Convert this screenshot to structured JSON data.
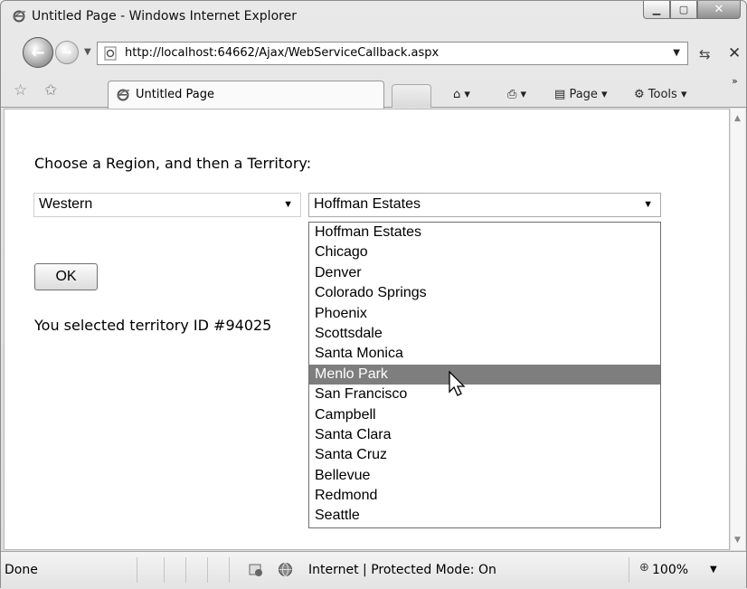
{
  "window": {
    "title": "Untitled Page - Windows Internet Explorer",
    "buttons": [
      "minimize",
      "maximize",
      "close"
    ]
  },
  "navigation": {
    "back_icon": "back-arrow-icon",
    "forward_icon": "forward-arrow-icon",
    "url": "http://localhost:64662/Ajax/WebServiceCallback.aspx"
  },
  "tabs": {
    "active_label": "Untitled Page"
  },
  "command_bar": {
    "page_label": "Page",
    "tools_label": "Tools",
    "overflow": "»"
  },
  "page": {
    "heading": "Choose a Region, and then a Territory:",
    "region_select": {
      "value": "Western"
    },
    "territory_select": {
      "value": "Hoffman Estates",
      "options": [
        "Hoffman Estates",
        "Chicago",
        "Denver",
        "Colorado Springs",
        "Phoenix",
        "Scottsdale",
        "Santa Monica",
        "Menlo Park",
        "San Francisco",
        "Campbell",
        "Santa Clara",
        "Santa Cruz",
        "Bellevue",
        "Redmond",
        "Seattle"
      ],
      "highlighted_option": "Menlo Park"
    },
    "ok_button": "OK",
    "result_text": "You selected territory ID #94025"
  },
  "status_bar": {
    "status": "Done",
    "zone": "Internet | Protected Mode: On",
    "zoom": "100%"
  }
}
